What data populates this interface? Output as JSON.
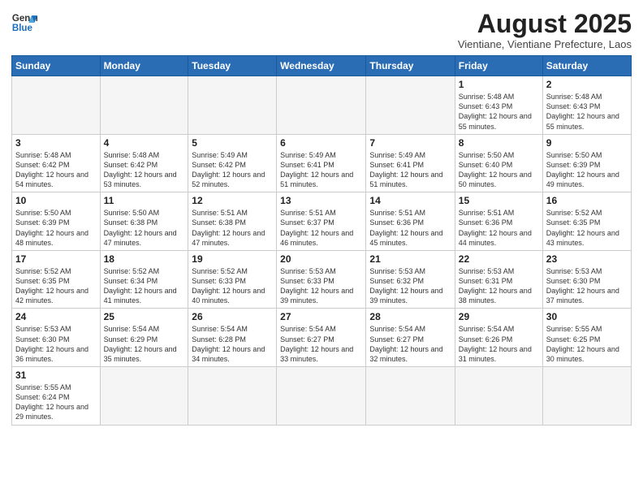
{
  "logo": {
    "line1": "General",
    "line2": "Blue"
  },
  "title": "August 2025",
  "location": "Vientiane, Vientiane Prefecture, Laos",
  "weekdays": [
    "Sunday",
    "Monday",
    "Tuesday",
    "Wednesday",
    "Thursday",
    "Friday",
    "Saturday"
  ],
  "weeks": [
    [
      {
        "day": "",
        "info": ""
      },
      {
        "day": "",
        "info": ""
      },
      {
        "day": "",
        "info": ""
      },
      {
        "day": "",
        "info": ""
      },
      {
        "day": "",
        "info": ""
      },
      {
        "day": "1",
        "info": "Sunrise: 5:48 AM\nSunset: 6:43 PM\nDaylight: 12 hours\nand 55 minutes."
      },
      {
        "day": "2",
        "info": "Sunrise: 5:48 AM\nSunset: 6:43 PM\nDaylight: 12 hours\nand 55 minutes."
      }
    ],
    [
      {
        "day": "3",
        "info": "Sunrise: 5:48 AM\nSunset: 6:42 PM\nDaylight: 12 hours\nand 54 minutes."
      },
      {
        "day": "4",
        "info": "Sunrise: 5:48 AM\nSunset: 6:42 PM\nDaylight: 12 hours\nand 53 minutes."
      },
      {
        "day": "5",
        "info": "Sunrise: 5:49 AM\nSunset: 6:42 PM\nDaylight: 12 hours\nand 52 minutes."
      },
      {
        "day": "6",
        "info": "Sunrise: 5:49 AM\nSunset: 6:41 PM\nDaylight: 12 hours\nand 51 minutes."
      },
      {
        "day": "7",
        "info": "Sunrise: 5:49 AM\nSunset: 6:41 PM\nDaylight: 12 hours\nand 51 minutes."
      },
      {
        "day": "8",
        "info": "Sunrise: 5:50 AM\nSunset: 6:40 PM\nDaylight: 12 hours\nand 50 minutes."
      },
      {
        "day": "9",
        "info": "Sunrise: 5:50 AM\nSunset: 6:39 PM\nDaylight: 12 hours\nand 49 minutes."
      }
    ],
    [
      {
        "day": "10",
        "info": "Sunrise: 5:50 AM\nSunset: 6:39 PM\nDaylight: 12 hours\nand 48 minutes."
      },
      {
        "day": "11",
        "info": "Sunrise: 5:50 AM\nSunset: 6:38 PM\nDaylight: 12 hours\nand 47 minutes."
      },
      {
        "day": "12",
        "info": "Sunrise: 5:51 AM\nSunset: 6:38 PM\nDaylight: 12 hours\nand 47 minutes."
      },
      {
        "day": "13",
        "info": "Sunrise: 5:51 AM\nSunset: 6:37 PM\nDaylight: 12 hours\nand 46 minutes."
      },
      {
        "day": "14",
        "info": "Sunrise: 5:51 AM\nSunset: 6:36 PM\nDaylight: 12 hours\nand 45 minutes."
      },
      {
        "day": "15",
        "info": "Sunrise: 5:51 AM\nSunset: 6:36 PM\nDaylight: 12 hours\nand 44 minutes."
      },
      {
        "day": "16",
        "info": "Sunrise: 5:52 AM\nSunset: 6:35 PM\nDaylight: 12 hours\nand 43 minutes."
      }
    ],
    [
      {
        "day": "17",
        "info": "Sunrise: 5:52 AM\nSunset: 6:35 PM\nDaylight: 12 hours\nand 42 minutes."
      },
      {
        "day": "18",
        "info": "Sunrise: 5:52 AM\nSunset: 6:34 PM\nDaylight: 12 hours\nand 41 minutes."
      },
      {
        "day": "19",
        "info": "Sunrise: 5:52 AM\nSunset: 6:33 PM\nDaylight: 12 hours\nand 40 minutes."
      },
      {
        "day": "20",
        "info": "Sunrise: 5:53 AM\nSunset: 6:33 PM\nDaylight: 12 hours\nand 39 minutes."
      },
      {
        "day": "21",
        "info": "Sunrise: 5:53 AM\nSunset: 6:32 PM\nDaylight: 12 hours\nand 39 minutes."
      },
      {
        "day": "22",
        "info": "Sunrise: 5:53 AM\nSunset: 6:31 PM\nDaylight: 12 hours\nand 38 minutes."
      },
      {
        "day": "23",
        "info": "Sunrise: 5:53 AM\nSunset: 6:30 PM\nDaylight: 12 hours\nand 37 minutes."
      }
    ],
    [
      {
        "day": "24",
        "info": "Sunrise: 5:53 AM\nSunset: 6:30 PM\nDaylight: 12 hours\nand 36 minutes."
      },
      {
        "day": "25",
        "info": "Sunrise: 5:54 AM\nSunset: 6:29 PM\nDaylight: 12 hours\nand 35 minutes."
      },
      {
        "day": "26",
        "info": "Sunrise: 5:54 AM\nSunset: 6:28 PM\nDaylight: 12 hours\nand 34 minutes."
      },
      {
        "day": "27",
        "info": "Sunrise: 5:54 AM\nSunset: 6:27 PM\nDaylight: 12 hours\nand 33 minutes."
      },
      {
        "day": "28",
        "info": "Sunrise: 5:54 AM\nSunset: 6:27 PM\nDaylight: 12 hours\nand 32 minutes."
      },
      {
        "day": "29",
        "info": "Sunrise: 5:54 AM\nSunset: 6:26 PM\nDaylight: 12 hours\nand 31 minutes."
      },
      {
        "day": "30",
        "info": "Sunrise: 5:55 AM\nSunset: 6:25 PM\nDaylight: 12 hours\nand 30 minutes."
      }
    ],
    [
      {
        "day": "31",
        "info": "Sunrise: 5:55 AM\nSunset: 6:24 PM\nDaylight: 12 hours\nand 29 minutes."
      },
      {
        "day": "",
        "info": ""
      },
      {
        "day": "",
        "info": ""
      },
      {
        "day": "",
        "info": ""
      },
      {
        "day": "",
        "info": ""
      },
      {
        "day": "",
        "info": ""
      },
      {
        "day": "",
        "info": ""
      }
    ]
  ]
}
